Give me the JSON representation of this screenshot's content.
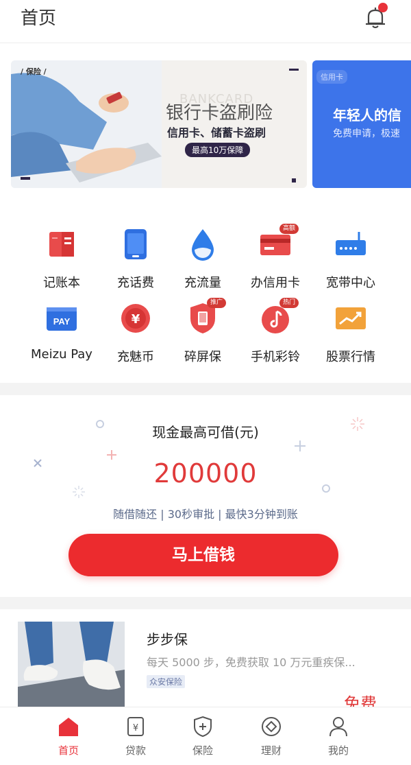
{
  "header": {
    "title": "首页"
  },
  "banner": {
    "main": {
      "tag": "/ 保险 /",
      "watermark": "BANKCARD",
      "title": "银行卡盗刷险",
      "subtitle": "信用卡、储蓄卡盗刷",
      "pill": "最高10万保障"
    },
    "side": {
      "tag": "信用卡",
      "title": "年轻人的信",
      "subtitle": "免费申请，极速"
    }
  },
  "grid": [
    {
      "label": "记账本",
      "icon": "notebook-icon",
      "badge": ""
    },
    {
      "label": "充话费",
      "icon": "phone-icon",
      "badge": ""
    },
    {
      "label": "充流量",
      "icon": "droplet-icon",
      "badge": ""
    },
    {
      "label": "办信用卡",
      "icon": "credit-card-icon",
      "badge": "高额"
    },
    {
      "label": "宽带中心",
      "icon": "router-icon",
      "badge": ""
    },
    {
      "label": "Meizu Pay",
      "icon": "pay-icon",
      "badge": ""
    },
    {
      "label": "充魅币",
      "icon": "yen-coin-icon",
      "badge": ""
    },
    {
      "label": "碎屏保",
      "icon": "shield-screen-icon",
      "badge": "推广"
    },
    {
      "label": "手机彩铃",
      "icon": "music-note-icon",
      "badge": "热门"
    },
    {
      "label": "股票行情",
      "icon": "stock-chart-icon",
      "badge": ""
    }
  ],
  "loan": {
    "title": "现金最高可借(元)",
    "amount": "200000",
    "desc": "随借随还 | 30秒审批 | 最快3分钟到账",
    "button": "马上借钱"
  },
  "card": {
    "title": "步步保",
    "desc": "每天 5000 步，免费获取 10 万元重疾保...",
    "tag": "众安保险",
    "price": "免费"
  },
  "tabbar": [
    {
      "label": "首页",
      "icon": "home-icon",
      "active": true
    },
    {
      "label": "贷款",
      "icon": "loan-icon",
      "active": false
    },
    {
      "label": "保险",
      "icon": "insurance-shield-icon",
      "active": false
    },
    {
      "label": "理财",
      "icon": "finance-icon",
      "active": false
    },
    {
      "label": "我的",
      "icon": "user-icon",
      "active": false
    }
  ],
  "colors": {
    "accent": "#e8323a",
    "blue": "#3d74ea",
    "banner_dark": "#2f2548"
  }
}
